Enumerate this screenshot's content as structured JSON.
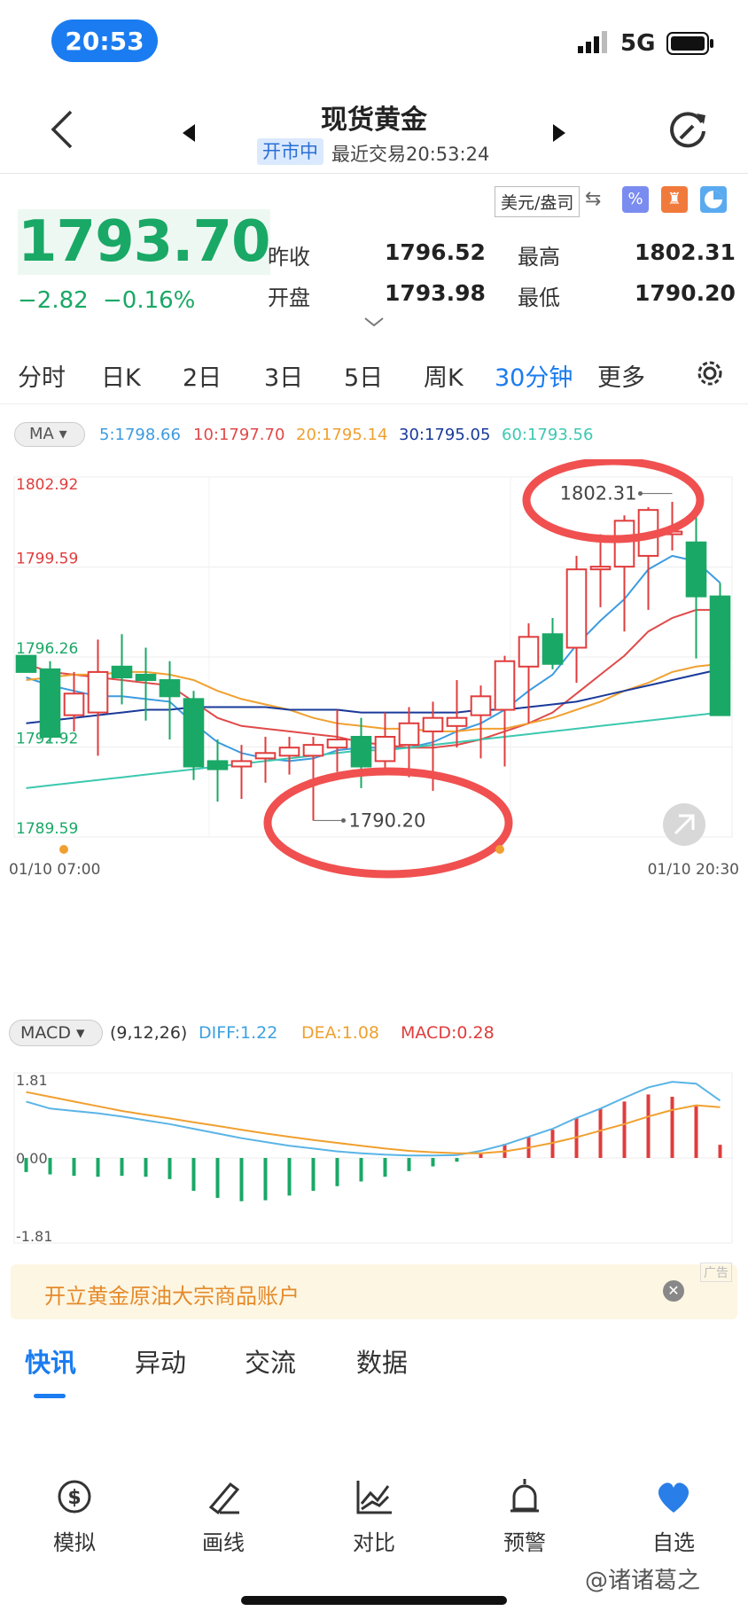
{
  "status_bar": {
    "time": "20:53",
    "network": "5G"
  },
  "header": {
    "title": "现货黄金",
    "market_status": "开市中",
    "last_trade": "最近交易20:53:24"
  },
  "quote": {
    "price": "1793.70",
    "change": "−2.82",
    "change_pct": "−0.16%",
    "currency_unit": "美元/盎司",
    "prev_close_label": "昨收",
    "prev_close": "1796.52",
    "open_label": "开盘",
    "open": "1793.98",
    "high_label": "最高",
    "high": "1802.31",
    "low_label": "最低",
    "low": "1790.20"
  },
  "period_tabs": [
    "分时",
    "日K",
    "2日",
    "3日",
    "5日",
    "周K",
    "30分钟",
    "更多"
  ],
  "active_period": "30分钟",
  "ma_bar": {
    "selector": "MA",
    "ma5": "5:1798.66",
    "ma10": "10:1797.70",
    "ma20": "20:1795.14",
    "ma30": "30:1795.05",
    "ma60": "60:1793.56"
  },
  "macd_bar": {
    "selector": "MACD",
    "params": "(9,12,26)",
    "diff": "DIFF:1.22",
    "dea": "DEA:1.08",
    "macd": "MACD:0.28"
  },
  "ad_banner": {
    "text": "开立黄金原油大宗商品账户",
    "tag": "广告"
  },
  "news_tabs": [
    "快讯",
    "异动",
    "交流",
    "数据"
  ],
  "active_news_tab": "快讯",
  "bottom_nav": [
    {
      "label": "模拟",
      "icon": "simulate-icon"
    },
    {
      "label": "画线",
      "icon": "draw-line-icon"
    },
    {
      "label": "对比",
      "icon": "compare-icon"
    },
    {
      "label": "预警",
      "icon": "alert-icon"
    },
    {
      "label": "自选",
      "icon": "heart-icon"
    }
  ],
  "watermark": "@诸诸葛之",
  "colors": {
    "up": "#e03c3c",
    "down": "#1aa866",
    "accent": "#1a7cf0",
    "ma5": "#3d9be0",
    "ma10": "#e04a4a",
    "ma20": "#f0a030",
    "ma30": "#1a3a9a",
    "ma60": "#3cc8b0"
  },
  "chart_data": [
    {
      "type": "candlestick",
      "title": "",
      "ylim": [
        1789.59,
        1802.92
      ],
      "y_ticks": [
        "1802.92",
        "1799.59",
        "1796.26",
        "1792.92",
        "1789.59"
      ],
      "x_start_label": "01/10 07:00",
      "x_end_label": "01/10 20:30",
      "high_marker": "1802.31",
      "low_marker": "1790.20",
      "candles": [
        {
          "o": 1796.3,
          "h": 1796.3,
          "c": 1795.7,
          "l": 1795.7
        },
        {
          "o": 1795.8,
          "h": 1796.1,
          "c": 1793.3,
          "l": 1793.1
        },
        {
          "o": 1794.1,
          "h": 1795.7,
          "c": 1794.9,
          "l": 1793.5
        },
        {
          "o": 1794.2,
          "h": 1796.9,
          "c": 1795.7,
          "l": 1792.6
        },
        {
          "o": 1795.9,
          "h": 1797.1,
          "c": 1795.5,
          "l": 1794.5
        },
        {
          "o": 1795.6,
          "h": 1796.6,
          "c": 1795.4,
          "l": 1793.9
        },
        {
          "o": 1795.4,
          "h": 1796.1,
          "c": 1794.8,
          "l": 1793.2
        },
        {
          "o": 1794.7,
          "h": 1795.0,
          "c": 1792.2,
          "l": 1791.7
        },
        {
          "o": 1792.4,
          "h": 1793.2,
          "c": 1792.1,
          "l": 1790.9
        },
        {
          "o": 1792.2,
          "h": 1793.0,
          "c": 1792.4,
          "l": 1791.0
        },
        {
          "o": 1792.5,
          "h": 1793.3,
          "c": 1792.7,
          "l": 1791.6
        },
        {
          "o": 1792.6,
          "h": 1793.3,
          "c": 1792.9,
          "l": 1791.9
        },
        {
          "o": 1792.6,
          "h": 1793.3,
          "c": 1793.0,
          "l": 1790.2
        },
        {
          "o": 1792.9,
          "h": 1794.3,
          "c": 1793.2,
          "l": 1792.0
        },
        {
          "o": 1793.3,
          "h": 1794.0,
          "c": 1792.2,
          "l": 1791.4
        },
        {
          "o": 1792.4,
          "h": 1794.2,
          "c": 1793.3,
          "l": 1791.9
        },
        {
          "o": 1793.0,
          "h": 1794.4,
          "c": 1793.8,
          "l": 1791.8
        },
        {
          "o": 1793.5,
          "h": 1794.6,
          "c": 1794.0,
          "l": 1791.3
        },
        {
          "o": 1793.7,
          "h": 1795.4,
          "c": 1794.0,
          "l": 1792.9
        },
        {
          "o": 1794.1,
          "h": 1795.2,
          "c": 1794.8,
          "l": 1792.5
        },
        {
          "o": 1794.3,
          "h": 1796.3,
          "c": 1796.1,
          "l": 1792.2
        },
        {
          "o": 1795.9,
          "h": 1797.5,
          "c": 1797.0,
          "l": 1793.8
        },
        {
          "o": 1797.1,
          "h": 1797.7,
          "c": 1796.0,
          "l": 1795.8
        },
        {
          "o": 1796.6,
          "h": 1800.0,
          "c": 1799.5,
          "l": 1795.3
        },
        {
          "o": 1799.5,
          "h": 1800.8,
          "c": 1799.6,
          "l": 1798.1
        },
        {
          "o": 1799.6,
          "h": 1801.5,
          "c": 1801.3,
          "l": 1797.2
        },
        {
          "o": 1800.0,
          "h": 1801.8,
          "c": 1801.7,
          "l": 1798.0
        },
        {
          "o": 1800.8,
          "h": 1802.0,
          "c": 1800.9,
          "l": 1800.2
        },
        {
          "o": 1800.5,
          "h": 1801.7,
          "c": 1798.5,
          "l": 1796.2
        },
        {
          "o": 1798.5,
          "h": 1799.0,
          "c": 1794.1,
          "l": 1794.1
        }
      ],
      "ma_series": [
        {
          "name": "MA5",
          "values": [
            1795.5,
            1795.2,
            1795.0,
            1794.8,
            1794.8,
            1794.7,
            1794.6,
            1793.8,
            1793.1,
            1792.7,
            1792.5,
            1792.4,
            1792.5,
            1792.8,
            1792.9,
            1792.9,
            1792.9,
            1793.1,
            1793.5,
            1793.8,
            1794.3,
            1795.0,
            1795.6,
            1796.7,
            1797.6,
            1798.4,
            1799.5,
            1800.0,
            1799.8,
            1799.0
          ]
        },
        {
          "name": "MA10",
          "values": [
            1796.0,
            1795.7,
            1795.6,
            1795.5,
            1795.4,
            1795.3,
            1795.2,
            1794.6,
            1794.0,
            1793.7,
            1793.6,
            1793.5,
            1793.4,
            1793.3,
            1793.1,
            1793.0,
            1792.9,
            1792.9,
            1793.0,
            1793.2,
            1793.5,
            1793.8,
            1794.2,
            1794.9,
            1795.6,
            1796.3,
            1797.2,
            1797.7,
            1798.0,
            1798.0
          ]
        },
        {
          "name": "MA20",
          "values": [
            1795.4,
            1795.5,
            1795.6,
            1795.6,
            1795.7,
            1795.7,
            1795.6,
            1795.4,
            1795.0,
            1794.7,
            1794.5,
            1794.3,
            1794.0,
            1793.8,
            1793.7,
            1793.6,
            1793.6,
            1793.5,
            1793.5,
            1793.6,
            1793.6,
            1793.8,
            1794.0,
            1794.3,
            1794.6,
            1795.0,
            1795.3,
            1795.7,
            1795.9,
            1796.0
          ]
        },
        {
          "name": "MA30",
          "values": [
            1793.8,
            1793.9,
            1794.0,
            1794.1,
            1794.2,
            1794.3,
            1794.3,
            1794.4,
            1794.4,
            1794.4,
            1794.4,
            1794.3,
            1794.3,
            1794.3,
            1794.2,
            1794.2,
            1794.2,
            1794.2,
            1794.2,
            1794.3,
            1794.3,
            1794.4,
            1794.5,
            1794.6,
            1794.8,
            1795.0,
            1795.2,
            1795.4,
            1795.6,
            1795.8
          ]
        },
        {
          "name": "MA60",
          "values": [
            1791.4,
            1791.5,
            1791.6,
            1791.7,
            1791.8,
            1791.9,
            1792.0,
            1792.1,
            1792.2,
            1792.3,
            1792.4,
            1792.5,
            1792.6,
            1792.7,
            1792.8,
            1792.8,
            1792.9,
            1793.0,
            1793.1,
            1793.2,
            1793.3,
            1793.4,
            1793.5,
            1793.6,
            1793.7,
            1793.8,
            1793.9,
            1794.0,
            1794.1,
            1794.2
          ]
        }
      ]
    },
    {
      "type": "bar",
      "title": "",
      "ylim": [
        -1.81,
        1.81
      ],
      "y_ticks": [
        "1.81",
        "0.00",
        "-1.81"
      ],
      "macd_values": [
        -0.3,
        -0.35,
        -0.38,
        -0.4,
        -0.38,
        -0.4,
        -0.45,
        -0.7,
        -0.85,
        -0.92,
        -0.9,
        -0.8,
        -0.7,
        -0.6,
        -0.5,
        -0.4,
        -0.28,
        -0.18,
        -0.08,
        0.1,
        0.3,
        0.45,
        0.6,
        0.85,
        1.05,
        1.2,
        1.35,
        1.3,
        1.1,
        0.28
      ],
      "diff_values": [
        1.2,
        1.05,
        1.0,
        0.95,
        0.88,
        0.8,
        0.72,
        0.62,
        0.52,
        0.42,
        0.34,
        0.26,
        0.2,
        0.14,
        0.1,
        0.07,
        0.05,
        0.05,
        0.06,
        0.15,
        0.28,
        0.45,
        0.62,
        0.85,
        1.05,
        1.28,
        1.5,
        1.62,
        1.58,
        1.22
      ],
      "dea_values": [
        1.4,
        1.3,
        1.2,
        1.1,
        1.0,
        0.92,
        0.84,
        0.76,
        0.68,
        0.6,
        0.52,
        0.45,
        0.38,
        0.32,
        0.26,
        0.2,
        0.15,
        0.12,
        0.1,
        0.1,
        0.14,
        0.22,
        0.32,
        0.44,
        0.58,
        0.72,
        0.88,
        1.02,
        1.12,
        1.08
      ]
    }
  ]
}
